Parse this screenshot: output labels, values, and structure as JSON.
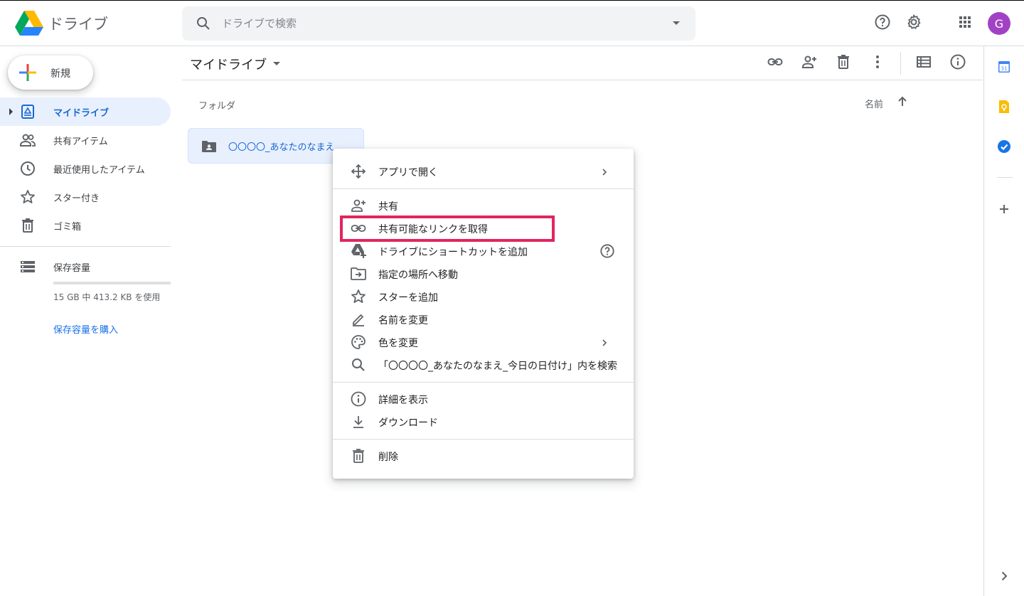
{
  "header": {
    "app_name": "ドライブ",
    "search_placeholder": "ドライブで検索",
    "avatar_letter": "G",
    "avatar_color": "#a142c5"
  },
  "sidebar": {
    "new_label": "新規",
    "items": [
      {
        "label": "マイドライブ",
        "icon": "my-drive-icon",
        "active": true
      },
      {
        "label": "共有アイテム",
        "icon": "shared-icon"
      },
      {
        "label": "最近使用したアイテム",
        "icon": "clock-icon"
      },
      {
        "label": "スター付き",
        "icon": "star-icon"
      },
      {
        "label": "ゴミ箱",
        "icon": "trash-icon"
      }
    ],
    "storage": {
      "label": "保存容量",
      "usage": "15 GB 中 413.2 KB を使用",
      "buy_label": "保存容量を購入"
    }
  },
  "main": {
    "breadcrumb": "マイドライブ",
    "section_label": "フォルダ",
    "sort_label": "名前",
    "folder_name": "〇〇〇〇_あなたのなまえ_今日の日付け"
  },
  "context_menu": {
    "items": [
      {
        "label": "アプリで開く",
        "icon": "open-with-icon"
      },
      {
        "label": "共有",
        "icon": "person-add-icon"
      },
      {
        "label": "共有可能なリンクを取得",
        "icon": "link-icon"
      },
      {
        "label": "ドライブにショートカットを追加",
        "icon": "drive-shortcut-icon"
      },
      {
        "label": "指定の場所へ移動",
        "icon": "move-to-folder-icon"
      },
      {
        "label": "スターを追加",
        "icon": "star-icon"
      },
      {
        "label": "名前を変更",
        "icon": "pencil-icon"
      },
      {
        "label": "色を変更",
        "icon": "palette-icon"
      },
      {
        "label": "「〇〇〇〇_あなたのなまえ_今日の日付け」内を検索",
        "icon": "search-icon"
      },
      {
        "label": "詳細を表示",
        "icon": "info-icon"
      },
      {
        "label": "ダウンロード",
        "icon": "download-icon"
      },
      {
        "label": "削除",
        "icon": "trash-icon"
      }
    ],
    "highlight_color": "#e2255d"
  },
  "rightbar": {
    "calendar_day": "31"
  },
  "colors": {
    "accent": "#1a73e8",
    "active_bg": "#e8f0fe"
  }
}
